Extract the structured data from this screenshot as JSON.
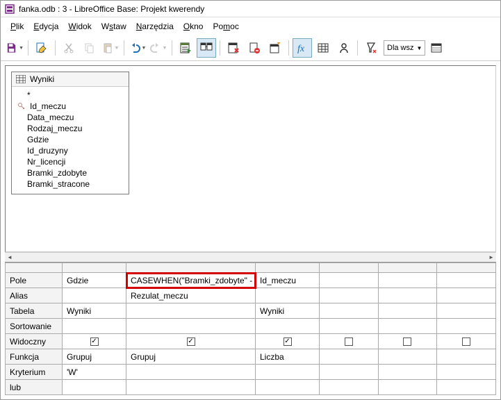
{
  "window": {
    "title": "fanka.odb : 3 - LibreOffice Base: Projekt kwerendy"
  },
  "menu": {
    "plik": "Plik",
    "edycja": "Edycja",
    "widok": "Widok",
    "wstaw": "Wstaw",
    "narzedzia": "Narzędzia",
    "okno": "Okno",
    "pomoc": "Pomoc"
  },
  "toolbar": {
    "forall": "Dla wsz"
  },
  "table_panel": {
    "title": "Wyniki",
    "fields": [
      {
        "name": "*",
        "key": false
      },
      {
        "name": "Id_meczu",
        "key": true
      },
      {
        "name": "Data_meczu",
        "key": false
      },
      {
        "name": "Rodzaj_meczu",
        "key": false
      },
      {
        "name": "Gdzie",
        "key": false
      },
      {
        "name": "Id_druzyny",
        "key": false
      },
      {
        "name": "Nr_licencji",
        "key": false
      },
      {
        "name": "Bramki_zdobyte",
        "key": false
      },
      {
        "name": "Bramki_stracone",
        "key": false
      }
    ]
  },
  "grid": {
    "headers": {
      "pole": "Pole",
      "alias": "Alias",
      "tabela": "Tabela",
      "sortowanie": "Sortowanie",
      "widoczny": "Widoczny",
      "funkcja": "Funkcja",
      "kryterium": "Kryterium",
      "lub": "lub"
    },
    "cols": [
      {
        "pole": "Gdzie",
        "alias": "",
        "tabela": "Wyniki",
        "widoczny": true,
        "funkcja": "Grupuj",
        "kryterium": "'W'"
      },
      {
        "pole": "CASEWHEN(\"Bramki_zdobyte\" -",
        "alias": "Rezulat_meczu",
        "tabela": "",
        "widoczny": true,
        "funkcja": "Grupuj",
        "kryterium": "",
        "highlight": true
      },
      {
        "pole": "Id_meczu",
        "alias": "",
        "tabela": "Wyniki",
        "widoczny": true,
        "funkcja": "Liczba",
        "kryterium": ""
      },
      {
        "pole": "",
        "alias": "",
        "tabela": "",
        "widoczny": false,
        "funkcja": "",
        "kryterium": ""
      },
      {
        "pole": "",
        "alias": "",
        "tabela": "",
        "widoczny": false,
        "funkcja": "",
        "kryterium": ""
      },
      {
        "pole": "",
        "alias": "",
        "tabela": "",
        "widoczny": false,
        "funkcja": "",
        "kryterium": ""
      }
    ]
  }
}
